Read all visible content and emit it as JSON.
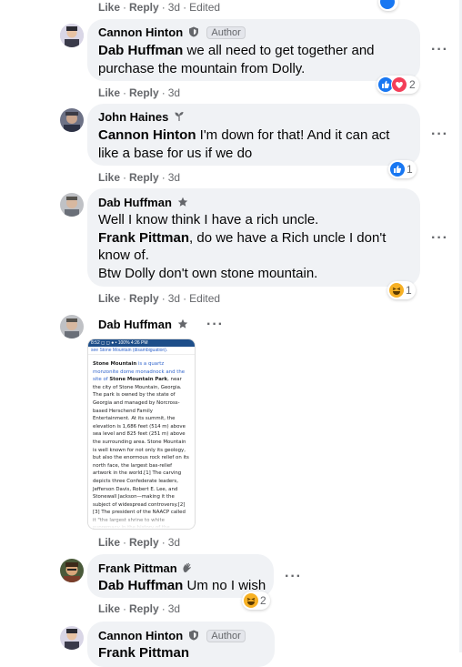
{
  "top_actions": {
    "like": "Like",
    "reply": "Reply",
    "time": "3d",
    "edited": "Edited"
  },
  "comments": [
    {
      "author": "Cannon Hinton",
      "badge": "Author",
      "mention": "Dab Huffman",
      "line1": " we all need to get together and",
      "line2": "purchase the mountain from Dolly.",
      "like": "Like",
      "reply": "Reply",
      "time": "3d",
      "reactions": {
        "count": "2",
        "icons": [
          "like-icon",
          "love-icon"
        ]
      }
    },
    {
      "author": "John Haines",
      "mention": "Cannon Hinton",
      "line1": " I'm down for that! And it can act",
      "line2": "like a base for us if we do",
      "like": "Like",
      "reply": "Reply",
      "time": "3d",
      "reactions": {
        "count": "1",
        "icons": [
          "like-icon"
        ]
      }
    },
    {
      "author": "Dab Huffman",
      "line1": "Well I know think I have a rich uncle.",
      "mention": "Frank Pittman",
      "line2": ", do we have a Rich uncle I don't",
      "line3": "know of.",
      "line4": "Btw Dolly don't own stone mountain.",
      "like": "Like",
      "reply": "Reply",
      "time": "3d",
      "edited": "Edited",
      "reactions": {
        "count": "1",
        "icons": [
          "haha-icon"
        ]
      }
    },
    {
      "author": "Dab Huffman",
      "like": "Like",
      "reply": "Reply",
      "time": "3d",
      "image": {
        "status": "8:52 ◻ ◻ ● • 100% 4:26 PM",
        "sub": "see Stone Mountain (disambiguation).",
        "p1": "Stone Mountain",
        "p2": " is a quartz monzonite dome monadnock and the site of ",
        "p3": "Stone Mountain Park",
        "p4": ", near the city of Stone Mountain, Georgia. The park is owned by the state of Georgia and managed by Norcross-based Herschend Family Entertainment. At its summit, the elevation is 1,686 feet (514 m) above sea level and 825 feet (251 m) above the surrounding area. Stone Mountain is well known for not only its geology, but also the enormous rock relief on its north face, the largest bas-relief artwork in the world.[1] The carving depicts three Confederate leaders, Jefferson Davis, Robert E. Lee, and Stonewall Jackson—making it the subject of widespread controversy.[2][3] The president of the NAACP called it \"the largest shrine to white supremacy in the history of the"
      }
    },
    {
      "author": "Frank Pittman",
      "mention": "Dab Huffman",
      "line1": " Um no I wish",
      "like": "Like",
      "reply": "Reply",
      "time": "3d",
      "reactions": {
        "count": "2",
        "icons": [
          "haha-icon"
        ]
      }
    },
    {
      "author": "Cannon Hinton",
      "badge": "Author",
      "mention": "Frank Pittman"
    }
  ],
  "colors": {
    "bubble": "#f0f2f5",
    "secondary_text": "#65676b",
    "like_blue": "#1877f2",
    "love_red": "#f33e58",
    "haha_yellow": "#f7b125"
  }
}
